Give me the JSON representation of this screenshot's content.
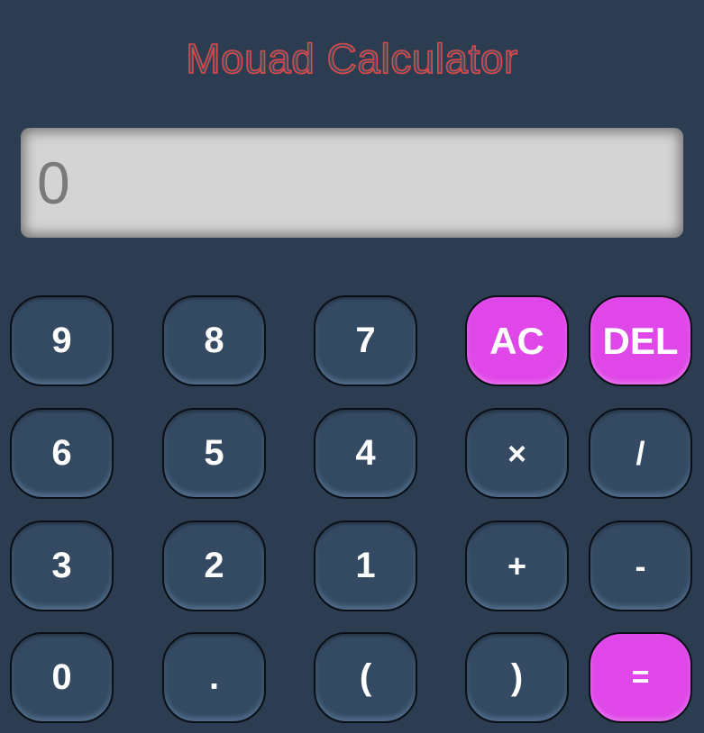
{
  "app": {
    "title": "Mouad Calculator",
    "display_value": "0"
  },
  "keys": {
    "k9": "9",
    "k8": "8",
    "k7": "7",
    "clear": "AC",
    "delete": "DEL",
    "k6": "6",
    "k5": "5",
    "k4": "4",
    "multiply": "×",
    "divide": "/",
    "k3": "3",
    "k2": "2",
    "k1": "1",
    "plus": "+",
    "minus": "-",
    "k0": "0",
    "dot": ".",
    "open_paren": "(",
    "close_paren": ")",
    "equals": "="
  },
  "colors": {
    "background": "#2c3d51",
    "key": "#344a62",
    "accent": "#e047e8",
    "title_stroke": "#e04848",
    "display": "#d4d4d4"
  }
}
